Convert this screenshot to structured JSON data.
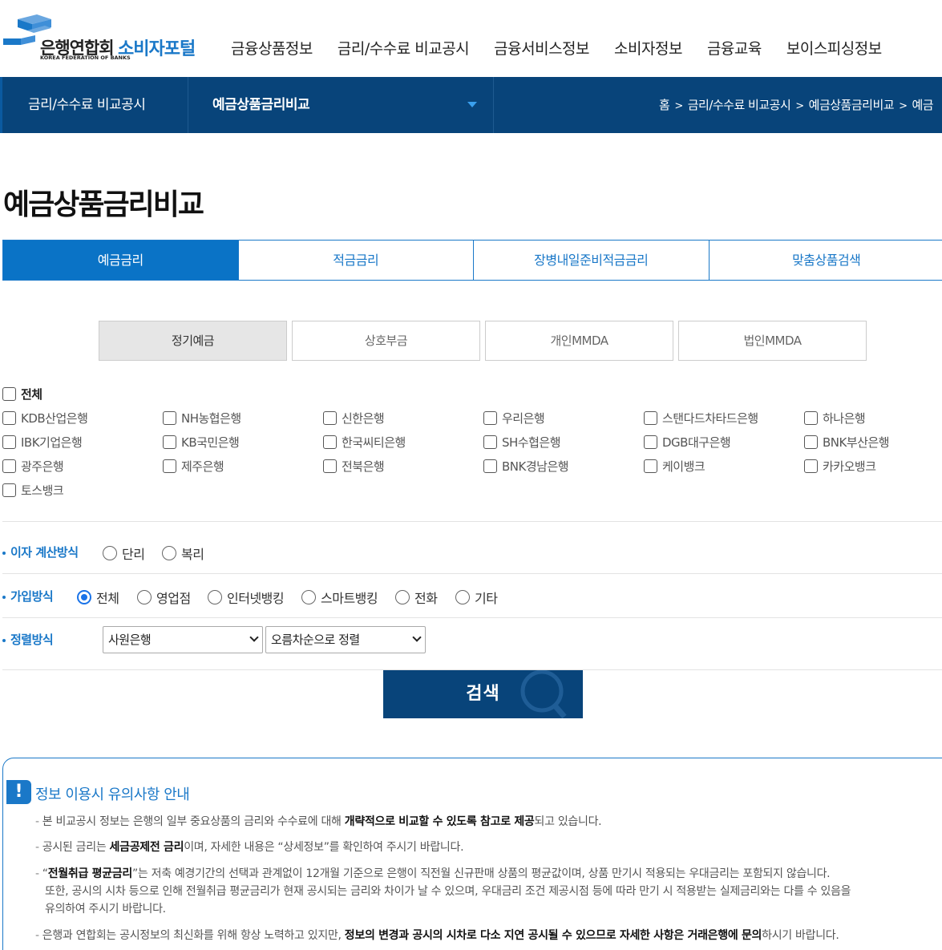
{
  "header": {
    "logo_text": "은행연합회",
    "logo_sub": "KOREA FEDERATION OF BANKS",
    "portal": "소비자포털",
    "brand_color": "#1a78c8",
    "nav": [
      "금융상품정보",
      "금리/수수료 비교공시",
      "금융서비스정보",
      "소비자정보",
      "금융교육",
      "보이스피싱정보"
    ]
  },
  "subbar": {
    "level1": "금리/수수료 비교공시",
    "level2": "예금상품금리비교",
    "bg_color": "#08447a",
    "breadcrumb": [
      "홈",
      "금리/수수료 비교공시",
      "예금상품금리비교",
      "예금"
    ]
  },
  "page_title": "예금상품금리비교",
  "main_tabs": [
    {
      "label": "예금금리",
      "active": true
    },
    {
      "label": "적금금리",
      "active": false
    },
    {
      "label": "장병내일준비적금금리",
      "active": false
    },
    {
      "label": "맞춤상품검색",
      "active": false
    }
  ],
  "sub_tabs": [
    {
      "label": "정기예금",
      "active": true
    },
    {
      "label": "상호부금",
      "active": false
    },
    {
      "label": "개인MMDA",
      "active": false
    },
    {
      "label": "법인MMDA",
      "active": false
    }
  ],
  "banks": {
    "all_label": "전체",
    "list": [
      "KDB산업은행",
      "NH농협은행",
      "신한은행",
      "우리은행",
      "스탠다드차타드은행",
      "하나은행",
      "IBK기업은행",
      "KB국민은행",
      "한국씨티은행",
      "SH수협은행",
      "DGB대구은행",
      "BNK부산은행",
      "광주은행",
      "제주은행",
      "전북은행",
      "BNK경남은행",
      "케이뱅크",
      "카카오뱅크",
      "토스뱅크"
    ]
  },
  "interest_method": {
    "label": "이자 계산방식",
    "options": [
      "단리",
      "복리"
    ],
    "selected": null
  },
  "join_method": {
    "label": "가입방식",
    "options": [
      "전체",
      "영업점",
      "인터넷뱅킹",
      "스마트뱅킹",
      "전화",
      "기타"
    ],
    "selected": "전체"
  },
  "sort_method": {
    "label": "정렬방식",
    "select1": "사원은행",
    "select2": "오름차순으로 정렬"
  },
  "search_label": "검색",
  "notice": {
    "title": "정보 이용시 유의사항 안내",
    "items": [
      {
        "pre": "본 비교공시 정보는 은행의 일부 중요상품의 금리와 수수료에 대해 ",
        "bold": "개략적으로 비교할 수 있도록 참고로 제공",
        "post": "되고 있습니다."
      },
      {
        "pre": "공시된 금리는 ",
        "bold": "세금공제전 금리",
        "post": "이며, 자세한 내용은 “상세정보”를 확인하여 주시기 바랍니다."
      },
      {
        "pre": "“",
        "bold": "전월취급 평균금리",
        "post": "”는 저축 예경기간의 선택과 관계없이 12개월 기준으로 은행이 직전월 신규판매 상품의 평균값이며, 상품 만기시 적용되는 우대금리는 포함되지 않습니다.",
        "cont": [
          "또한, 공시의 시차 등으로 인해 전월취급 평균금리가 현재 공시되는 금리와 차이가 날 수 있으며, 우대금리 조건 제공시점 등에 따라 만기 시 적용받는 실제금리와는 다를 수 있음을",
          "유의하여 주시기 바랍니다."
        ]
      },
      {
        "pre": "은행과 연합회는 공시정보의 최신화를 위해 항상 노력하고 있지만, ",
        "bold": "정보의 변경과 공시의 시차로 다소 지연 공시될 수 있으므로 자세한 사항은 거래은행에 문의",
        "post": "하시기 바랍니다."
      }
    ]
  }
}
